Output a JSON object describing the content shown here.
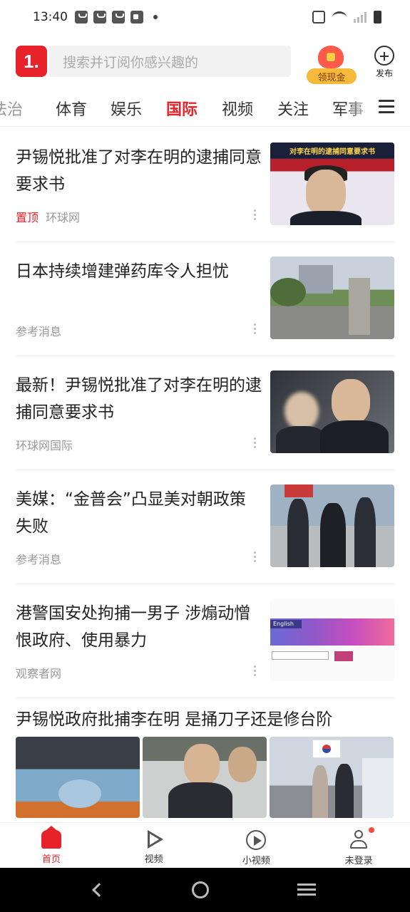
{
  "status_bar": {
    "time": "13:40"
  },
  "header": {
    "logo_text": "1.",
    "search_placeholder": "搜索并订阅你感兴趣的",
    "cash_label": "领现金",
    "publish_label": "发布"
  },
  "tabs": [
    "法治",
    "体育",
    "娱乐",
    "国际",
    "视频",
    "关注",
    "军事"
  ],
  "active_tab": "国际",
  "feed": [
    {
      "title": "尹锡悦批准了对李在明的逮捕同意要求书",
      "pin": "置顶",
      "source": "环球网",
      "thumb_caption": "对李在明的逮捕同意要求书"
    },
    {
      "title": "日本持续增建弹药库令人担忧",
      "source": "参考消息"
    },
    {
      "title": "最新！尹锡悦批准了对李在明的逮捕同意要求书",
      "source": "环球网国际"
    },
    {
      "title": "美媒：“金普会”凸显美对朝政策失败",
      "source": "参考消息"
    },
    {
      "title": "港警国安处拘捕一男子 涉煽动憎恨政府、使用暴力",
      "source": "观察者网",
      "thumb_caption": "English"
    }
  ],
  "feed_big": {
    "title": "尹锡悦政府批捕李在明 是捅刀子还是修台阶"
  },
  "bottom_nav": [
    {
      "label": "首页",
      "icon": "home-icon",
      "active": true
    },
    {
      "label": "视频",
      "icon": "play-icon"
    },
    {
      "label": "小视频",
      "icon": "circle-play-icon"
    },
    {
      "label": "未登录",
      "icon": "user-icon"
    }
  ],
  "colors": {
    "accent": "#e8222b"
  }
}
